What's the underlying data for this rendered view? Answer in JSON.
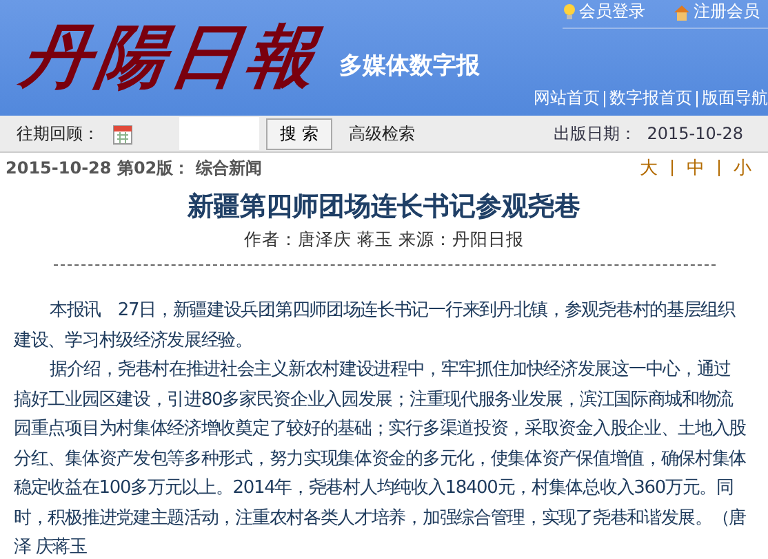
{
  "header": {
    "logo": "丹陽日報",
    "subtitle": "多媒体数字报",
    "member_links": [
      {
        "label": "会员登录",
        "kind": "bulb"
      },
      {
        "label": "注册会员",
        "kind": "house"
      }
    ],
    "nav_links": [
      "网站首页",
      "数字报首页",
      "版面导航"
    ]
  },
  "toolbar": {
    "archive_label": "往期回顾：",
    "search_button": "搜 索",
    "advanced_search": "高级检索",
    "publish_label": "出版日期：",
    "publish_date": "2015-10-28"
  },
  "dateline": {
    "date": "2015-10-28",
    "edition": "第02版：",
    "section": "综合新闻"
  },
  "font_sizes": [
    {
      "label": "大",
      "selected": false
    },
    {
      "label": "中",
      "selected": false
    },
    {
      "label": "小",
      "selected": false
    }
  ],
  "article": {
    "title": "新疆第四师团场连长书记参观尧巷",
    "byline": "作者：唐泽庆 蒋玉 来源：丹阳日报",
    "paragraphs": [
      "本报讯　27日，新疆建设兵团第四师团场连长书记一行来到丹北镇，参观尧巷村的基层组织建设、学习村级经济发展经验。",
      "据介绍，尧巷村在推进社会主义新农村建设进程中，牢牢抓住加快经济发展这一中心，通过搞好工业园区建设，引进80多家民资企业入园发展；注重现代服务业发展，滨江国际商城和物流园重点项目为村集体经济增收奠定了较好的基础；实行多渠道投资，采取资金入股企业、土地入股分红、集体资产发包等多种形式，努力实现集体资金的多元化，使集体资产保值增值，确保村集体稳定收益在100多万元以上。2014年，尧巷村人均纯收入18400元，村集体总收入360万元。同时，积极推进党建主题活动，注重农村各类人才培养，加强综合管理，实现了尧巷和谐发展。（唐泽 庆蒋玉"
    ]
  }
}
